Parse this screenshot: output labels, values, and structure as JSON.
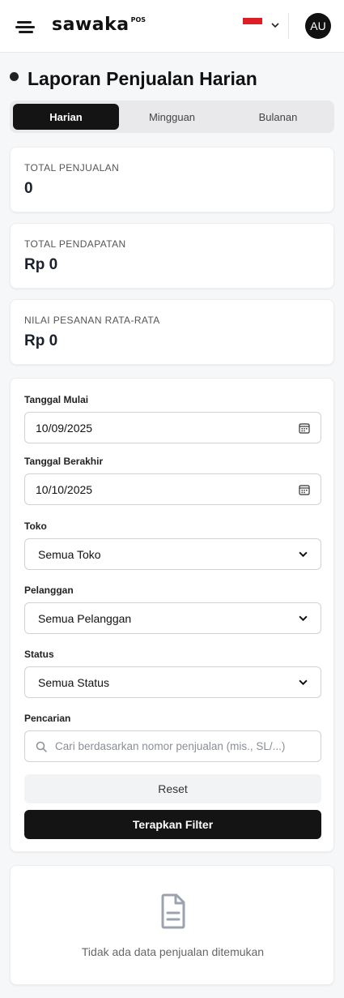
{
  "header": {
    "logo_text": "sawaka",
    "logo_sup": "POS",
    "avatar_initials": "AU",
    "flag_colors": {
      "top": "#dc1f26",
      "bottom": "#ffffff"
    }
  },
  "page": {
    "title": "Laporan Penjualan Harian"
  },
  "tabs": [
    {
      "label": "Harian",
      "active": true
    },
    {
      "label": "Mingguan",
      "active": false
    },
    {
      "label": "Bulanan",
      "active": false
    }
  ],
  "stats": [
    {
      "label": "TOTAL PENJUALAN",
      "value": "0"
    },
    {
      "label": "TOTAL PENDAPATAN",
      "value": "Rp 0"
    },
    {
      "label": "NILAI PESANAN RATA-RATA",
      "value": "Rp 0"
    }
  ],
  "filters": {
    "start_date": {
      "label": "Tanggal Mulai",
      "value": "10/09/2025"
    },
    "end_date": {
      "label": "Tanggal Berakhir",
      "value": "10/10/2025"
    },
    "store": {
      "label": "Toko",
      "value": "Semua Toko"
    },
    "customer": {
      "label": "Pelanggan",
      "value": "Semua Pelanggan"
    },
    "status": {
      "label": "Status",
      "value": "Semua Status"
    },
    "search": {
      "label": "Pencarian",
      "placeholder": "Cari berdasarkan nomor penjualan (mis., SL/...)"
    },
    "reset_label": "Reset",
    "apply_label": "Terapkan Filter"
  },
  "empty_state": {
    "message": "Tidak ada data penjualan ditemukan"
  },
  "colors": {
    "primary": "#141414",
    "background": "#f6f7f9",
    "muted_text": "#666666"
  }
}
